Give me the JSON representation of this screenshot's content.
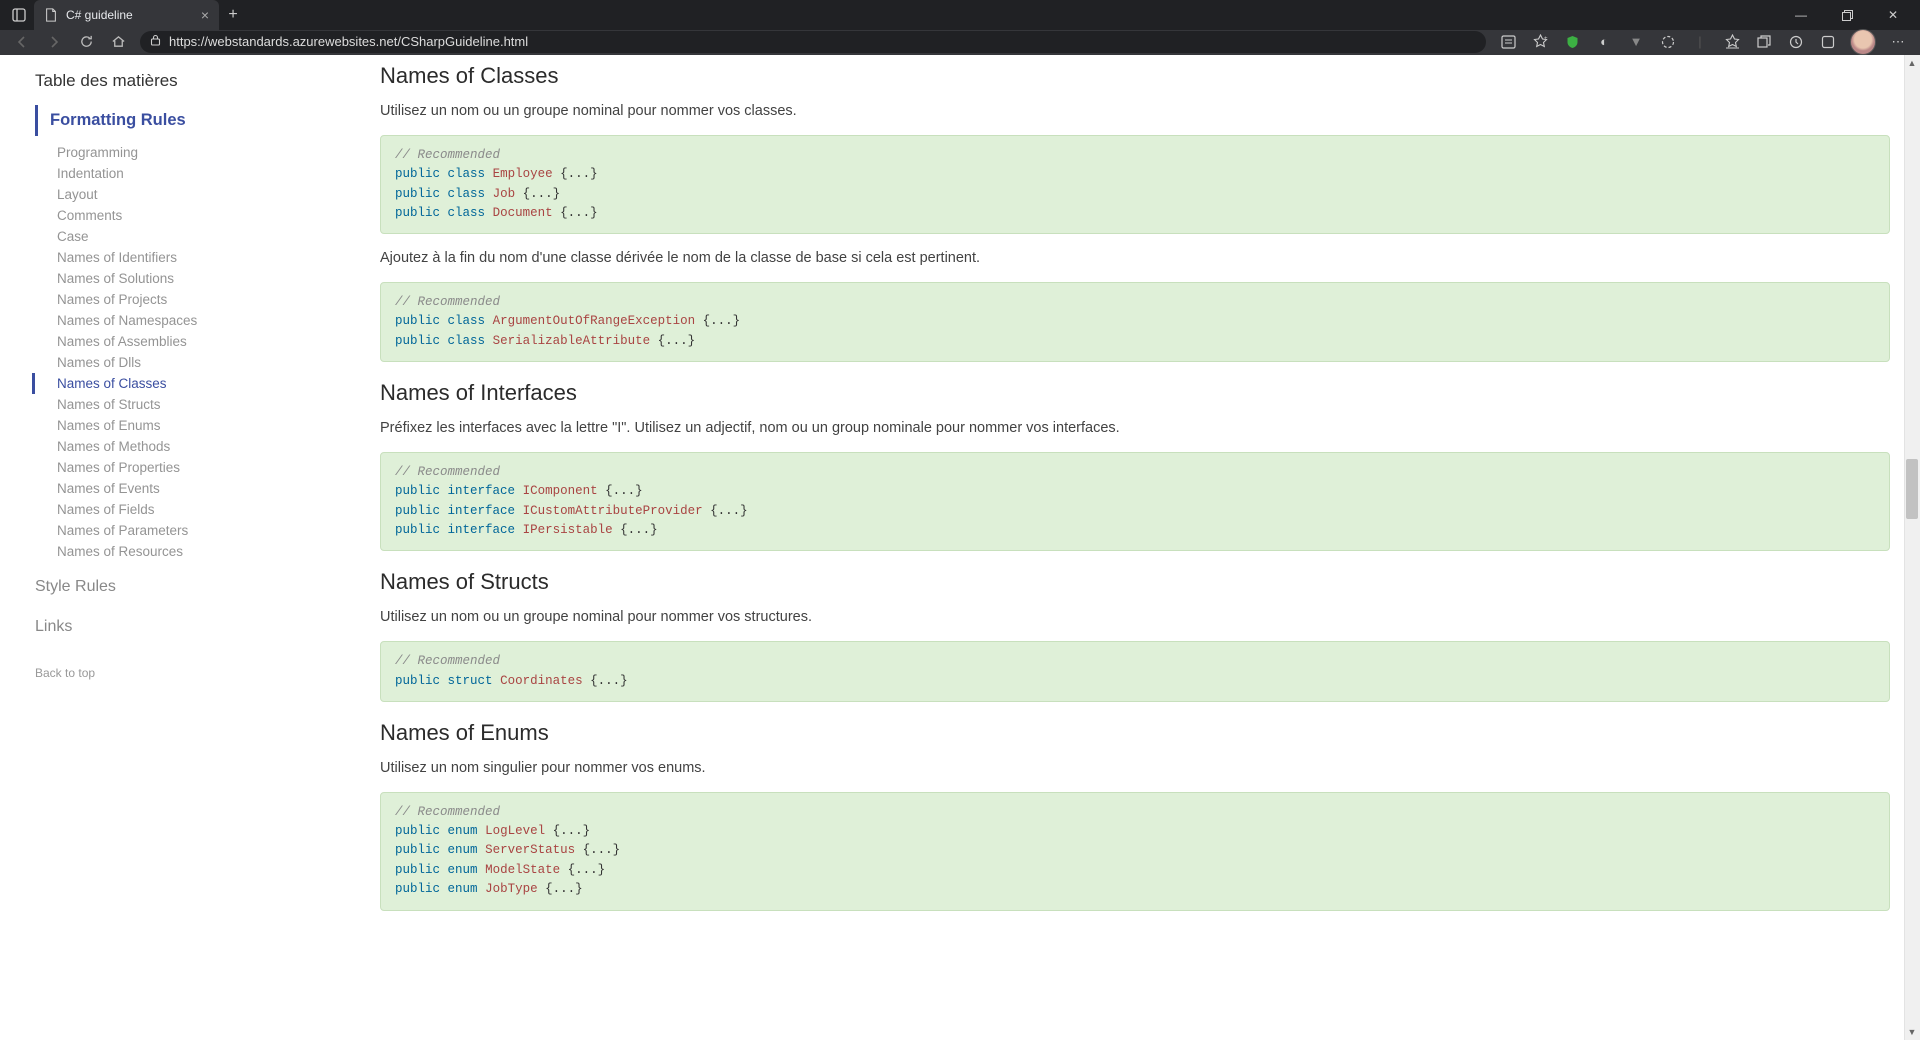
{
  "browser": {
    "tab_title": "C# guideline",
    "url": "https://webstandards.azurewebsites.net/CSharpGuideline.html"
  },
  "sidebar": {
    "toc_title": "Table des matières",
    "section_active": "Formatting Rules",
    "items": [
      "Programming",
      "Indentation",
      "Layout",
      "Comments",
      "Case",
      "Names of Identifiers",
      "Names of Solutions",
      "Names of Projects",
      "Names of Namespaces",
      "Names of Assemblies",
      "Names of Dlls",
      "Names of Classes",
      "Names of Structs",
      "Names of Enums",
      "Names of Methods",
      "Names of Properties",
      "Names of Events",
      "Names of Fields",
      "Names of Parameters",
      "Names of Resources"
    ],
    "active_index": 11,
    "section2": "Style Rules",
    "section3": "Links",
    "back_top": "Back to top"
  },
  "content": {
    "sec1": {
      "heading": "Names of Classes",
      "p1": "Utilisez un nom ou un groupe nominal pour nommer vos classes.",
      "code1_comment": "// Recommended",
      "code1_lines": [
        {
          "kw": "public class",
          "name": "Employee",
          "rest": " {...}"
        },
        {
          "kw": "public class",
          "name": "Job",
          "rest": " {...}"
        },
        {
          "kw": "public class",
          "name": "Document",
          "rest": " {...}"
        }
      ],
      "p2": "Ajoutez à la fin du nom d'une classe dérivée le nom de la classe de base si cela est pertinent.",
      "code2_comment": "// Recommended",
      "code2_lines": [
        {
          "kw": "public class",
          "name": "ArgumentOutOfRangeException",
          "rest": " {...}"
        },
        {
          "kw": "public class",
          "name": "SerializableAttribute",
          "rest": " {...}"
        }
      ]
    },
    "sec2": {
      "heading": "Names of Interfaces",
      "p1": "Préfixez les interfaces avec la lettre \"I\". Utilisez un adjectif, nom ou un group nominale pour nommer vos interfaces.",
      "code1_comment": "// Recommended",
      "code1_lines": [
        {
          "kw": "public interface",
          "name": "IComponent",
          "rest": " {...}"
        },
        {
          "kw": "public interface",
          "name": "ICustomAttributeProvider",
          "rest": " {...}"
        },
        {
          "kw": "public interface",
          "name": "IPersistable",
          "rest": " {...}"
        }
      ]
    },
    "sec3": {
      "heading": "Names of Structs",
      "p1": "Utilisez un nom ou un groupe nominal pour nommer vos structures.",
      "code1_comment": "// Recommended",
      "code1_lines": [
        {
          "kw": "public struct",
          "name": "Coordinates",
          "rest": " {...}"
        }
      ]
    },
    "sec4": {
      "heading": "Names of Enums",
      "p1": "Utilisez un nom singulier pour nommer vos enums.",
      "code1_comment": "// Recommended",
      "code1_lines": [
        {
          "kw": "public enum",
          "name": "LogLevel",
          "rest": " {...}"
        },
        {
          "kw": "public enum",
          "name": "ServerStatus",
          "rest": " {...}"
        },
        {
          "kw": "public enum",
          "name": "ModelState",
          "rest": " {...}"
        },
        {
          "kw": "public enum",
          "name": "JobType",
          "rest": " {...}"
        }
      ]
    }
  }
}
